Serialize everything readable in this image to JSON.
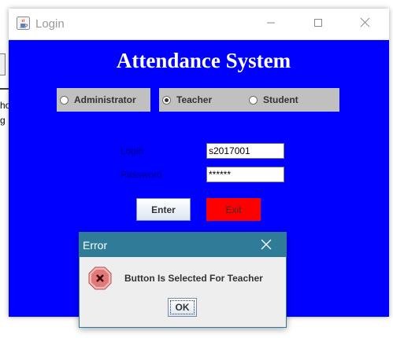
{
  "background_window": {
    "text_line1": "ho",
    "text_line2": "g"
  },
  "window": {
    "title": "Login",
    "icon": "java-cup-icon",
    "controls": [
      "minimize-icon",
      "maximize-icon",
      "close-icon"
    ]
  },
  "app": {
    "heading": "Attendance System",
    "roles": [
      {
        "label": "Administrator",
        "selected": false
      },
      {
        "label": "Teacher",
        "selected": true
      },
      {
        "label": "Student",
        "selected": false
      }
    ],
    "login_label": "Login",
    "login_value": "s2017001",
    "password_label": "Password",
    "password_value": "******",
    "enter_label": "Enter",
    "exit_label": "Exit"
  },
  "dialog": {
    "title": "Error",
    "message": "Button Is Selected For Teacher",
    "ok_label": "OK",
    "icon": "error-icon"
  },
  "colors": {
    "panel_background": "#0000ff",
    "exit_button": "#ff0000",
    "role_option_background": "#c0c0c0",
    "dialog_titlebar": "#2e7c98"
  }
}
